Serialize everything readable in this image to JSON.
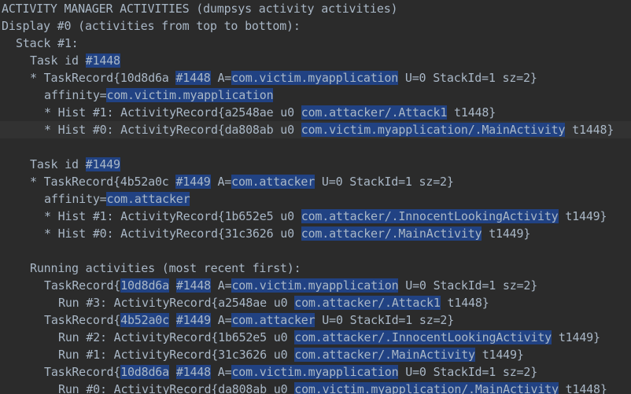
{
  "lines": [
    {
      "indent": 0,
      "current": false,
      "segments": [
        {
          "t": "ACTIVITY MANAGER ACTIVITIES (dumpsys activity activities)",
          "h": false
        }
      ]
    },
    {
      "indent": 0,
      "current": false,
      "segments": [
        {
          "t": "Display #0 (activities from top to bottom):",
          "h": false
        }
      ]
    },
    {
      "indent": 1,
      "current": false,
      "segments": [
        {
          "t": "Stack #1:",
          "h": false
        }
      ]
    },
    {
      "indent": 2,
      "current": false,
      "segments": [
        {
          "t": "Task id ",
          "h": false
        },
        {
          "t": "#1448",
          "h": true
        }
      ]
    },
    {
      "indent": 2,
      "current": false,
      "segments": [
        {
          "t": "* TaskRecord{10d8d6a ",
          "h": false
        },
        {
          "t": "#1448",
          "h": true
        },
        {
          "t": " A=",
          "h": false
        },
        {
          "t": "com.victim.myapplication",
          "h": true
        },
        {
          "t": " U=0 StackId=1 sz=2}",
          "h": false
        }
      ]
    },
    {
      "indent": 3,
      "current": false,
      "segments": [
        {
          "t": "affinity=",
          "h": false
        },
        {
          "t": "com.victim.myapplication",
          "h": true
        }
      ]
    },
    {
      "indent": 3,
      "current": false,
      "segments": [
        {
          "t": "* Hist #1: ActivityRecord{a2548ae u0 ",
          "h": false
        },
        {
          "t": "com.attacker/.Attack1",
          "h": true
        },
        {
          "t": " t1448}",
          "h": false
        }
      ]
    },
    {
      "indent": 3,
      "current": true,
      "segments": [
        {
          "t": "* Hist #0: ActivityRecord{da808ab u0 ",
          "h": false
        },
        {
          "t": "com.victim.myapplication/.MainActivity",
          "h": true
        },
        {
          "t": " t1448}",
          "h": false
        }
      ]
    },
    {
      "indent": 0,
      "current": false,
      "segments": [
        {
          "t": "",
          "h": false
        }
      ]
    },
    {
      "indent": 2,
      "current": false,
      "segments": [
        {
          "t": "Task id ",
          "h": false
        },
        {
          "t": "#1449",
          "h": true
        }
      ]
    },
    {
      "indent": 2,
      "current": false,
      "segments": [
        {
          "t": "* TaskRecord{4b52a0c ",
          "h": false
        },
        {
          "t": "#1449",
          "h": true
        },
        {
          "t": " A=",
          "h": false
        },
        {
          "t": "com.attacker",
          "h": true
        },
        {
          "t": " U=0 StackId=1 sz=2}",
          "h": false
        }
      ]
    },
    {
      "indent": 3,
      "current": false,
      "segments": [
        {
          "t": "affinity=",
          "h": false
        },
        {
          "t": "com.attacker",
          "h": true
        }
      ]
    },
    {
      "indent": 3,
      "current": false,
      "segments": [
        {
          "t": "* Hist #1: ActivityRecord{1b652e5 u0 ",
          "h": false
        },
        {
          "t": "com.attacker/.InnocentLookingActivity",
          "h": true
        },
        {
          "t": " t1449}",
          "h": false
        }
      ]
    },
    {
      "indent": 3,
      "current": false,
      "segments": [
        {
          "t": "* Hist #0: ActivityRecord{31c3626 u0 ",
          "h": false
        },
        {
          "t": "com.attacker/.MainActivity",
          "h": true
        },
        {
          "t": " t1449}",
          "h": false
        }
      ]
    },
    {
      "indent": 0,
      "current": false,
      "segments": [
        {
          "t": "",
          "h": false
        }
      ]
    },
    {
      "indent": 2,
      "current": false,
      "segments": [
        {
          "t": "Running activities (most recent first):",
          "h": false
        }
      ]
    },
    {
      "indent": 3,
      "current": false,
      "segments": [
        {
          "t": "TaskRecord{",
          "h": false
        },
        {
          "t": "10d8d6a",
          "h": true
        },
        {
          "t": " ",
          "h": false
        },
        {
          "t": "#1448",
          "h": true
        },
        {
          "t": " A=",
          "h": false
        },
        {
          "t": "com.victim.myapplication",
          "h": true
        },
        {
          "t": " U=0 StackId=1 sz=2}",
          "h": false
        }
      ]
    },
    {
      "indent": 4,
      "current": false,
      "segments": [
        {
          "t": "Run #3: ActivityRecord{a2548ae u0 ",
          "h": false
        },
        {
          "t": "com.attacker/.Attack1",
          "h": true
        },
        {
          "t": " t1448}",
          "h": false
        }
      ]
    },
    {
      "indent": 3,
      "current": false,
      "segments": [
        {
          "t": "TaskRecord{",
          "h": false
        },
        {
          "t": "4b52a0c",
          "h": true
        },
        {
          "t": " ",
          "h": false
        },
        {
          "t": "#1449",
          "h": true
        },
        {
          "t": " A=",
          "h": false
        },
        {
          "t": "com.attacker",
          "h": true
        },
        {
          "t": " U=0 StackId=1 sz=2}",
          "h": false
        }
      ]
    },
    {
      "indent": 4,
      "current": false,
      "segments": [
        {
          "t": "Run #2: ActivityRecord{1b652e5 u0 ",
          "h": false
        },
        {
          "t": "com.attacker/.InnocentLookingActivity",
          "h": true
        },
        {
          "t": " t1449}",
          "h": false
        }
      ]
    },
    {
      "indent": 4,
      "current": false,
      "segments": [
        {
          "t": "Run #1: ActivityRecord{31c3626 u0 ",
          "h": false
        },
        {
          "t": "com.attacker/.MainActivity",
          "h": true
        },
        {
          "t": " t1449}",
          "h": false
        }
      ]
    },
    {
      "indent": 3,
      "current": false,
      "segments": [
        {
          "t": "TaskRecord{",
          "h": false
        },
        {
          "t": "10d8d6a",
          "h": true
        },
        {
          "t": " ",
          "h": false
        },
        {
          "t": "#1448",
          "h": true
        },
        {
          "t": " A=",
          "h": false
        },
        {
          "t": "com.victim.myapplication",
          "h": true
        },
        {
          "t": " U=0 StackId=1 sz=2}",
          "h": false
        }
      ]
    },
    {
      "indent": 4,
      "current": false,
      "segments": [
        {
          "t": "Run #0: ActivityRecord{da808ab u0 ",
          "h": false
        },
        {
          "t": "com.victim.myapplication/.MainActivity",
          "h": true
        },
        {
          "t": " t1448}",
          "h": false
        }
      ]
    }
  ],
  "colors": {
    "background": "#2b2b2b",
    "text": "#a9b7c6",
    "highlight": "#214283",
    "current_line": "#323232"
  }
}
